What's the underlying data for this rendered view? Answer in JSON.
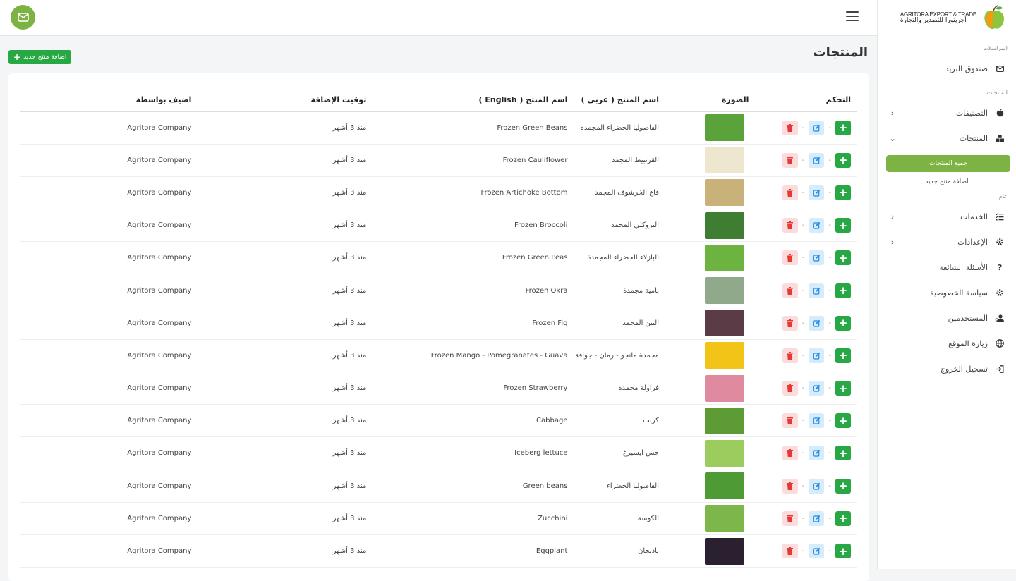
{
  "brand": {
    "name_en": "AGRITORA EXPORT & TRADE",
    "name_ar": "أجريتورا للتصدير والتجارة"
  },
  "sidebar": {
    "section_messages": "المراسلات",
    "mailbox": "صندوق البريد",
    "section_products": "المنتجات",
    "categories": "التصنيفات",
    "products": "المنتجات",
    "all_products": "جميع المنتجات",
    "add_product": "اضافة منتج جديد",
    "section_general": "عام",
    "services": "الخدمات",
    "settings": "الإعدادات",
    "faq": "الأسئلة الشائعة",
    "privacy": "سياسة الخصوصية",
    "users": "المستخدمين",
    "visit_site": "زيارة الموقع",
    "logout": "تسجيل الخروج"
  },
  "main": {
    "title": "المنتجات",
    "add_button": "اضافة منتج جديد"
  },
  "table": {
    "headers": {
      "control": "التحكم",
      "image": "الصورة",
      "name_ar": "اسم المنتج ( عربي )",
      "name_en": "اسم المنتج ( English )",
      "added_at": "توقيت الإضافة",
      "added_by": "اضيف بواسطة"
    },
    "rows": [
      {
        "name_ar": "الفاصوليا الخضراء المجمدة",
        "name_en": "Frozen Green Beans",
        "added_at": "منذ 3 أشهر",
        "added_by": "Agritora Company",
        "thumb_color": "#5aa33a"
      },
      {
        "name_ar": "القرنبيط المجمد",
        "name_en": "Frozen Cauliflower",
        "added_at": "منذ 3 أشهر",
        "added_by": "Agritora Company",
        "thumb_color": "#efe6cf"
      },
      {
        "name_ar": "قاع الخرشوف المجمد",
        "name_en": "Frozen Artichoke Bottom",
        "added_at": "منذ 3 أشهر",
        "added_by": "Agritora Company",
        "thumb_color": "#c9b27a"
      },
      {
        "name_ar": "البروكلي المجمد",
        "name_en": "Frozen Broccoli",
        "added_at": "منذ 3 أشهر",
        "added_by": "Agritora Company",
        "thumb_color": "#3f7d32"
      },
      {
        "name_ar": "البازلاء الخضراء المجمدة",
        "name_en": "Frozen Green Peas",
        "added_at": "منذ 3 أشهر",
        "added_by": "Agritora Company",
        "thumb_color": "#6cb33f"
      },
      {
        "name_ar": "بامية مجمدة",
        "name_en": "Frozen Okra",
        "added_at": "منذ 3 أشهر",
        "added_by": "Agritora Company",
        "thumb_color": "#8fa98a"
      },
      {
        "name_ar": "التين المجمد",
        "name_en": "Frozen Fig",
        "added_at": "منذ 3 أشهر",
        "added_by": "Agritora Company",
        "thumb_color": "#5a3b46"
      },
      {
        "name_ar": "مجمدة مانجو - رمان - جوافة",
        "name_en": "Frozen Mango - Pomegranates - Guava",
        "added_at": "منذ 3 أشهر",
        "added_by": "Agritora Company",
        "thumb_color": "#f2c418"
      },
      {
        "name_ar": "فراولة مجمدة",
        "name_en": "Frozen Strawberry",
        "added_at": "منذ 3 أشهر",
        "added_by": "Agritora Company",
        "thumb_color": "#e08aa0"
      },
      {
        "name_ar": "كرنب",
        "name_en": "Cabbage",
        "added_at": "منذ 3 أشهر",
        "added_by": "Agritora Company",
        "thumb_color": "#5d9c35"
      },
      {
        "name_ar": "خس ايسبرغ",
        "name_en": "Iceberg lettuce",
        "added_at": "منذ 3 أشهر",
        "added_by": "Agritora Company",
        "thumb_color": "#9ccb5e"
      },
      {
        "name_ar": "الفاصوليا الخضراء",
        "name_en": "Green beans",
        "added_at": "منذ 3 أشهر",
        "added_by": "Agritora Company",
        "thumb_color": "#4e9a35"
      },
      {
        "name_ar": "الكوسة",
        "name_en": "Zucchini",
        "added_at": "منذ 3 أشهر",
        "added_by": "Agritora Company",
        "thumb_color": "#7db64a"
      },
      {
        "name_ar": "باذنجان",
        "name_en": "Eggplant",
        "added_at": "منذ 3 أشهر",
        "added_by": "Agritora Company",
        "thumb_color": "#2b2030"
      }
    ]
  },
  "colors": {
    "accent": "#7cb342",
    "add": "#28a745",
    "edit_bg": "#d6ecfb",
    "edit_fg": "#1e88e5",
    "delete_bg": "#fbdcdc",
    "delete_fg": "#e53935"
  }
}
